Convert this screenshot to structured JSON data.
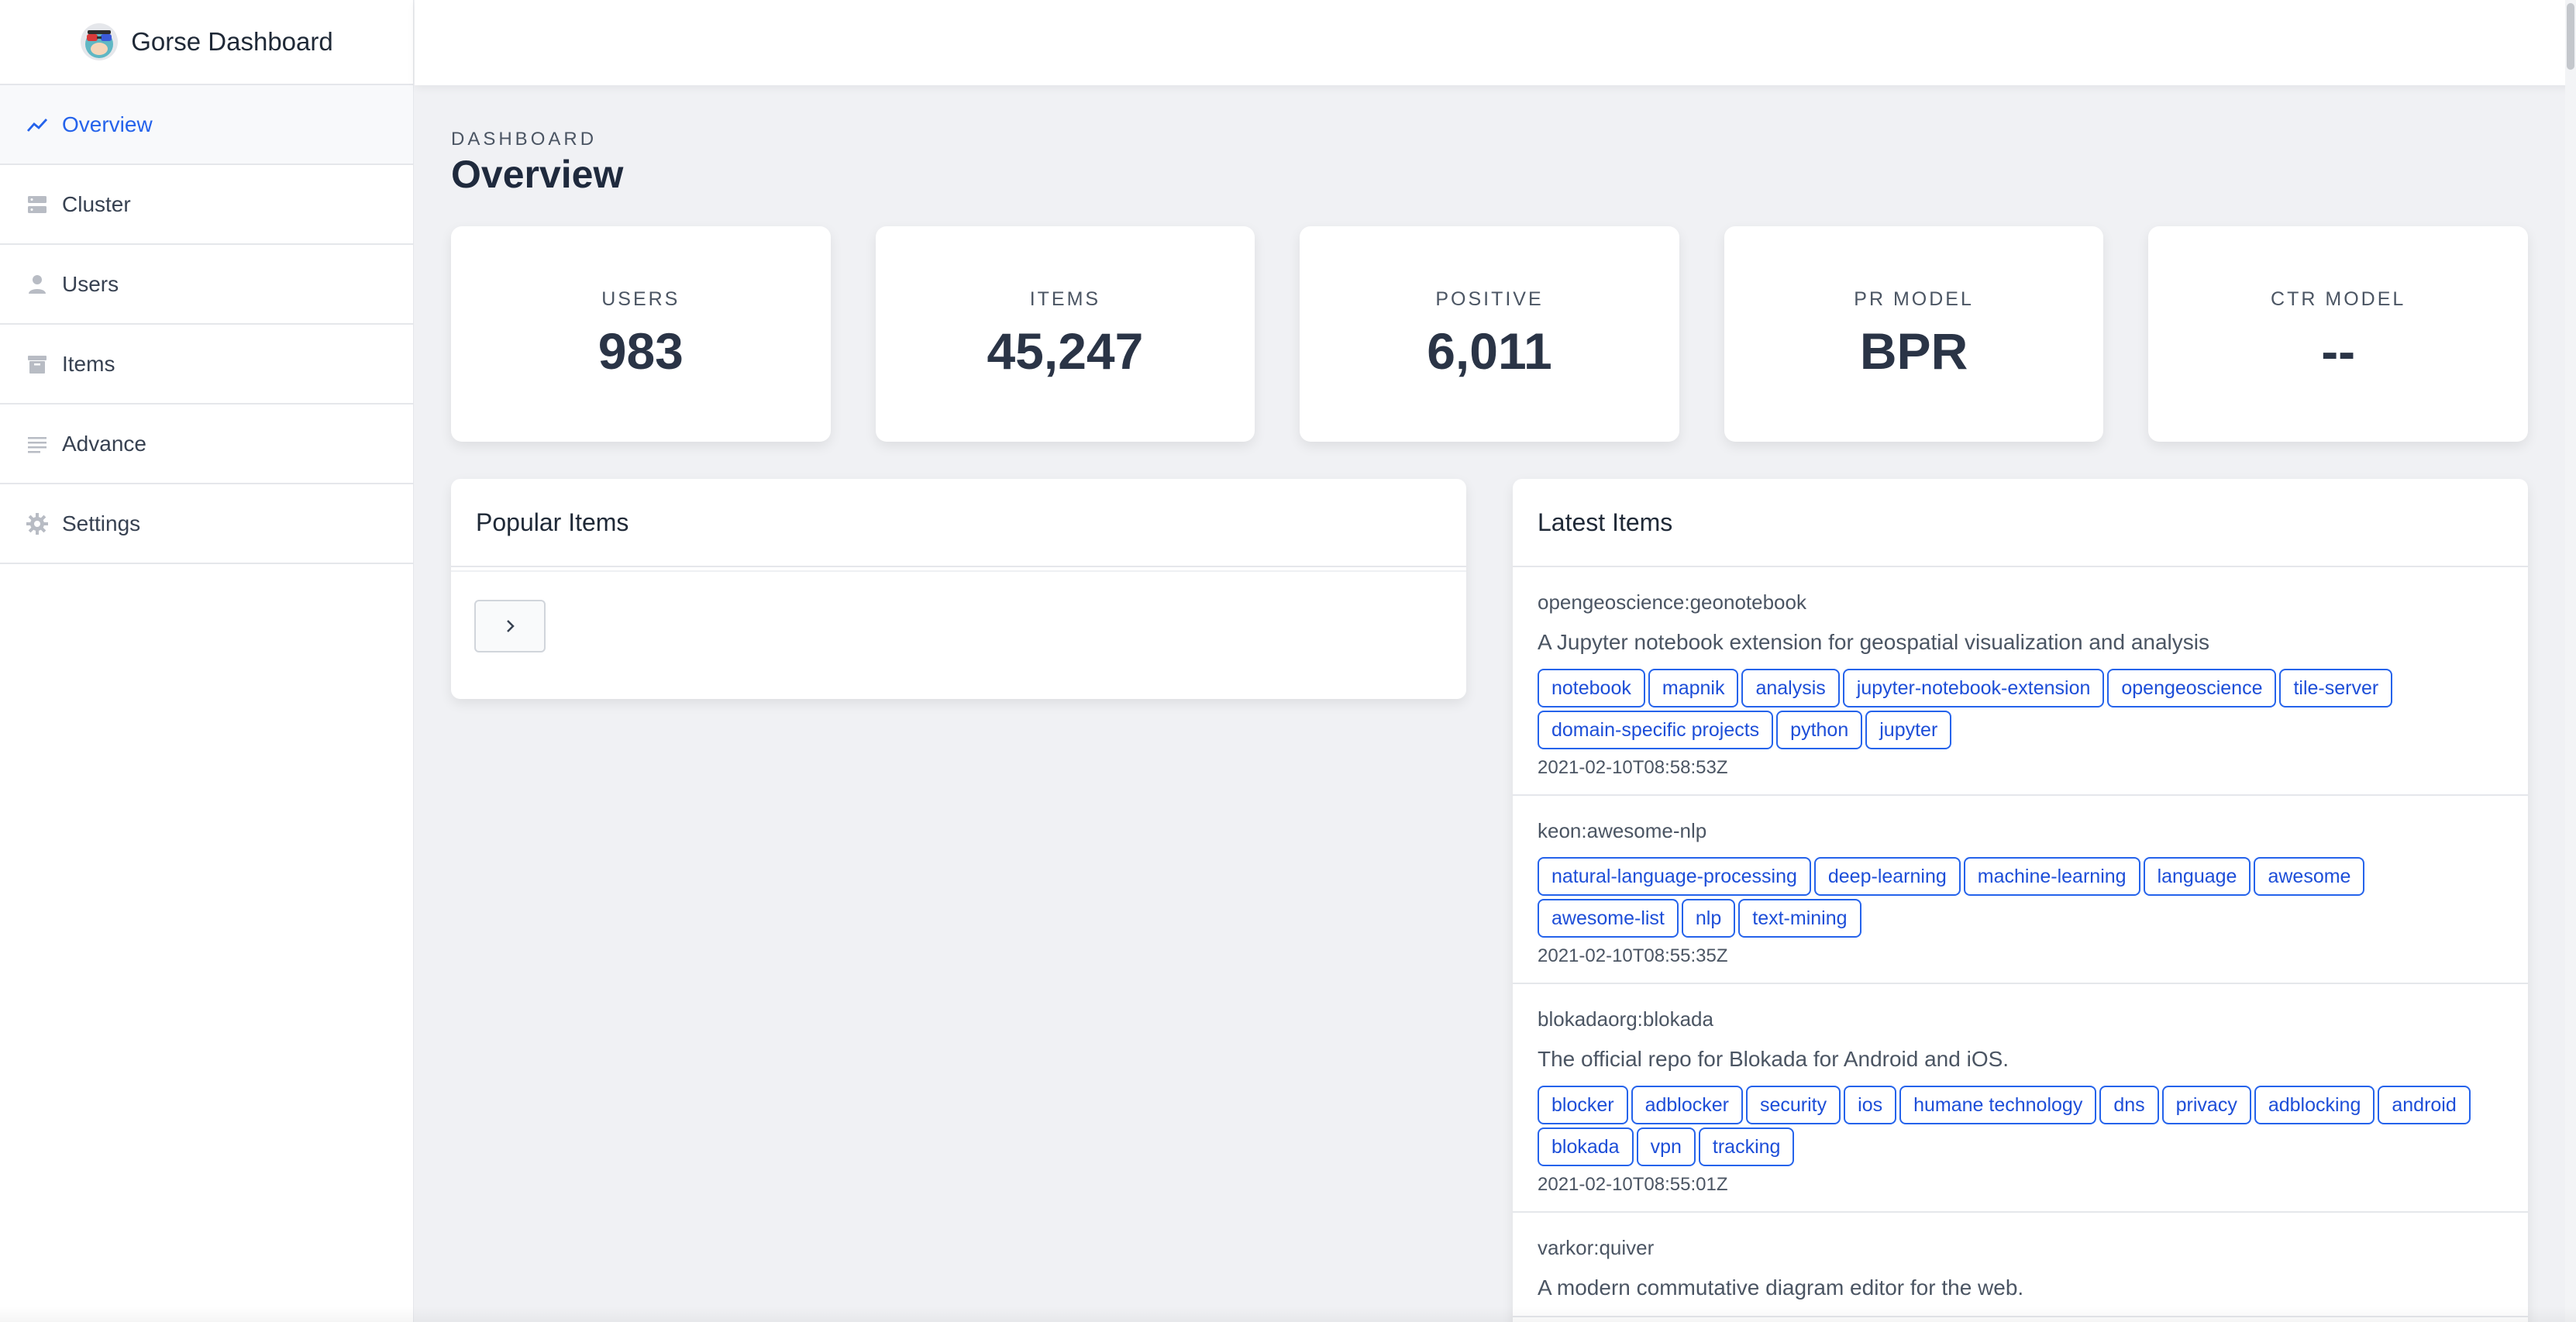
{
  "app": {
    "title": "Gorse Dashboard"
  },
  "sidebar": {
    "items": [
      {
        "label": "Overview",
        "icon": "trend-icon",
        "active": true
      },
      {
        "label": "Cluster",
        "icon": "server-icon"
      },
      {
        "label": "Users",
        "icon": "user-icon"
      },
      {
        "label": "Items",
        "icon": "archive-icon"
      },
      {
        "label": "Advance",
        "icon": "list-icon"
      },
      {
        "label": "Settings",
        "icon": "gear-icon"
      }
    ]
  },
  "header": {
    "eyebrow": "DASHBOARD",
    "title": "Overview"
  },
  "stats": [
    {
      "label": "USERS",
      "value": "983"
    },
    {
      "label": "ITEMS",
      "value": "45,247"
    },
    {
      "label": "POSITIVE",
      "value": "6,011"
    },
    {
      "label": "PR MODEL",
      "value": "BPR"
    },
    {
      "label": "CTR MODEL",
      "value": "--"
    }
  ],
  "popular": {
    "title": "Popular Items",
    "next_icon": "chevron-right-icon"
  },
  "latest": {
    "title": "Latest Items",
    "items": [
      {
        "name": "opengeoscience:geonotebook",
        "desc": "A Jupyter notebook extension for geospatial visualization and analysis",
        "tags": [
          "notebook",
          "mapnik",
          "analysis",
          "jupyter-notebook-extension",
          "opengeoscience",
          "tile-server",
          "domain-specific projects",
          "python",
          "jupyter"
        ],
        "time": "2021-02-10T08:58:53Z"
      },
      {
        "name": "keon:awesome-nlp",
        "desc": "",
        "tags": [
          "natural-language-processing",
          "deep-learning",
          "machine-learning",
          "language",
          "awesome",
          "awesome-list",
          "nlp",
          "text-mining"
        ],
        "time": "2021-02-10T08:55:35Z"
      },
      {
        "name": "blokadaorg:blokada",
        "desc": "The official repo for Blokada for Android and iOS.",
        "tags": [
          "blocker",
          "adblocker",
          "security",
          "ios",
          "humane technology",
          "dns",
          "privacy",
          "adblocking",
          "android",
          "blokada",
          "vpn",
          "tracking"
        ],
        "time": "2021-02-10T08:55:01Z"
      },
      {
        "name": "varkor:quiver",
        "desc": "A modern commutative diagram editor for the web.",
        "tags": [],
        "time": ""
      }
    ]
  },
  "colors": {
    "accent": "#2563eb",
    "sidebar_bg": "#ffffff",
    "content_bg": "#f0f1f4"
  }
}
